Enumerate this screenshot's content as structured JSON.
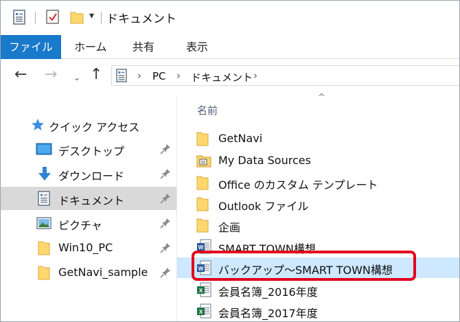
{
  "window": {
    "title": "ドキュメント",
    "qat_dropdown": "▾"
  },
  "ribbon": {
    "tabs": [
      {
        "label": "ファイル",
        "active": true
      },
      {
        "label": "ホーム"
      },
      {
        "label": "共有"
      },
      {
        "label": "表示"
      }
    ],
    "accent_color": "#1979ca"
  },
  "address": {
    "back": "←",
    "forward": "→",
    "history": "⌄",
    "up": "↑",
    "separator": "›",
    "path": [
      "PC",
      "ドキュメント"
    ]
  },
  "nav_pane": {
    "quick_access": {
      "label": "クイック アクセス",
      "icon": "star-icon"
    },
    "items": [
      {
        "label": "デスクトップ",
        "icon": "desktop-icon",
        "pinned": true
      },
      {
        "label": "ダウンロード",
        "icon": "download-icon",
        "pinned": true
      },
      {
        "label": "ドキュメント",
        "icon": "document-icon",
        "pinned": true,
        "selected": true
      },
      {
        "label": "ピクチャ",
        "icon": "picture-icon",
        "pinned": true
      },
      {
        "label": "Win10_PC",
        "icon": "folder-icon",
        "pinned": true
      },
      {
        "label": "GetNavi_sample",
        "icon": "folder-icon",
        "pinned": true
      }
    ]
  },
  "file_list": {
    "sort_indicator": "^",
    "column_name": "名前",
    "items": [
      {
        "name": "GetNavi",
        "type": "folder"
      },
      {
        "name": "My Data Sources",
        "type": "special-folder"
      },
      {
        "name": "Office のカスタム テンプレート",
        "type": "folder"
      },
      {
        "name": "Outlook ファイル",
        "type": "folder"
      },
      {
        "name": "企画",
        "type": "folder"
      },
      {
        "name": "SMART TOWN構想",
        "type": "word"
      },
      {
        "name": "バックアップ～SMART TOWN構想",
        "type": "word",
        "selected": true,
        "highlighted": true
      },
      {
        "name": "会員名簿_2016年度",
        "type": "excel"
      },
      {
        "name": "会員名簿_2017年度",
        "type": "excel"
      }
    ],
    "selection_color": "#cde8ff",
    "highlight_color": "#e3001b"
  }
}
